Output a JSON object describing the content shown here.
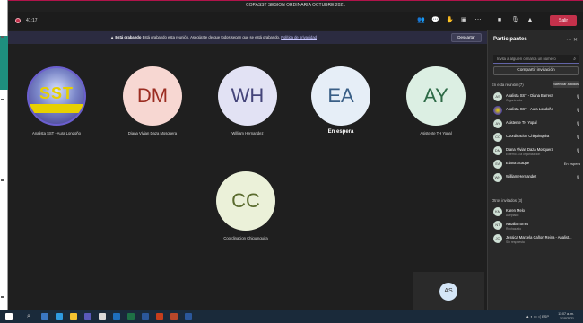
{
  "window": {
    "title": "COPASST SESION ORDINARIA OCTUBRE 2021"
  },
  "meeting": {
    "timer": "41:17",
    "leave_label": "Salir"
  },
  "recording_banner": {
    "bold": "Está grabando",
    "text": "Está grabando esta reunión. Asegúrate de que todos sepan que se está grabando.",
    "link": "Política de privacidad",
    "dismiss": "Descartar"
  },
  "stage": {
    "tiles": [
      {
        "initials": "SST",
        "name": "Analista SST - Aura Londoño",
        "color": "#3a2f86",
        "logo": true
      },
      {
        "initials": "DM",
        "name": "Diana Vivian Daza Mosquera",
        "color": "#f7d7d2",
        "text_color": "#9b2d22"
      },
      {
        "initials": "WH",
        "name": "William Hernandez",
        "color": "#e2e2f4",
        "text_color": "#45457a"
      },
      {
        "initials": "EA",
        "name": "En espera",
        "color": "#e6eef7",
        "text_color": "#3a5f86"
      },
      {
        "initials": "AY",
        "name": "Asistente TH Yopal",
        "color": "#dcefe3",
        "text_color": "#2e6b47"
      },
      {
        "initials": "CC",
        "name": "Coordinacion Chiquinquira",
        "color": "#ebf1d9",
        "text_color": "#5a6b2e"
      }
    ],
    "self_initials": "AS"
  },
  "panel": {
    "title": "Participantes",
    "invite_placeholder": "Invita a alguien o marca un número",
    "share_label": "Compartir invitación",
    "in_meeting_header": "En esta reunión (7)",
    "mute_all": "Silenciar a todos",
    "participants": [
      {
        "initials": "AS",
        "name": "Analista SST - Diana Barrera",
        "sub": "Organizador",
        "right": "🎙"
      },
      {
        "initials": "SST",
        "name": "Analista SST - Aura Londoño",
        "sub": "",
        "right": "🎙",
        "logo": true
      },
      {
        "initials": "AY",
        "name": "Asistente TH Yopal",
        "sub": "",
        "right": "🎙"
      },
      {
        "initials": "CC",
        "name": "Coordinacion Chiquinquira",
        "sub": "",
        "right": "🎙"
      },
      {
        "initials": "DM",
        "name": "Diana Vivian Daza Mosquera",
        "sub": "Externo a la organización",
        "right": "🎙"
      },
      {
        "initials": "EA",
        "name": "Eliana Acaque",
        "sub": "",
        "right": "En espera"
      },
      {
        "initials": "WH",
        "name": "William Hernandez",
        "sub": "",
        "right": "🎙"
      }
    ],
    "others_header": "Otros invitados (3)",
    "others": [
      {
        "initials": "KM",
        "name": "Karen Melo",
        "sub": "Aceptado"
      },
      {
        "initials": "NT",
        "name": "Natalia Torres",
        "sub": "Rechazado"
      },
      {
        "initials": "JC",
        "name": "Jessica Marcela Cañon Reina - Analist...",
        "sub": "Sin respuesta"
      }
    ]
  },
  "taskbar": {
    "time": "11:07 a. m.",
    "date": "1/10/2021",
    "lang": "ESP"
  }
}
